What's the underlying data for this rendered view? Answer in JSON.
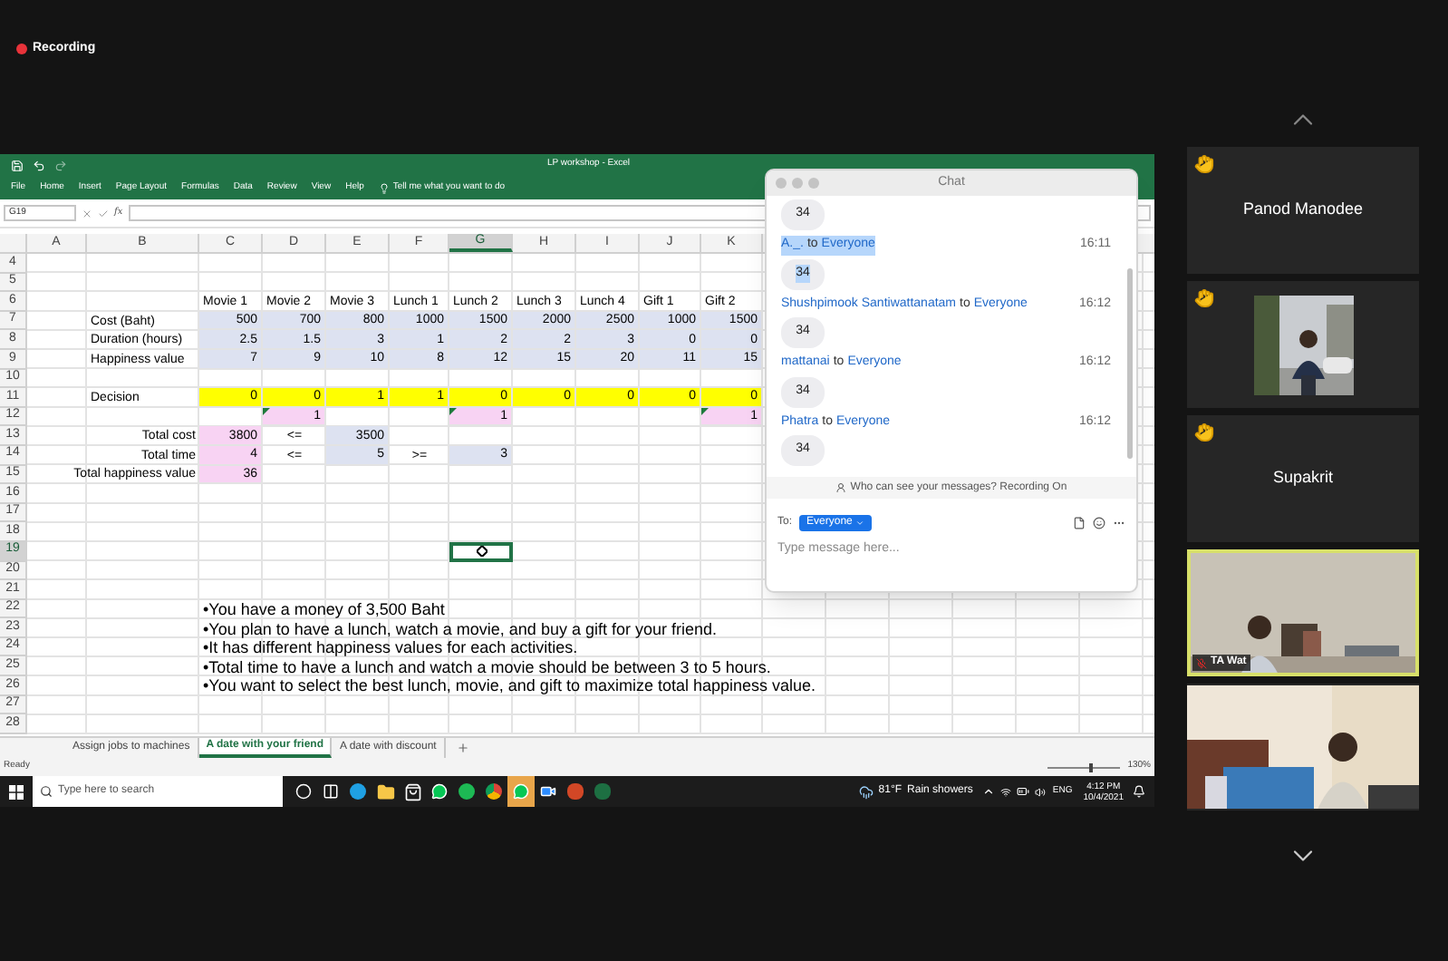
{
  "meeting": {
    "recording_label": "Recording"
  },
  "excel": {
    "title": "LP workshop - Excel",
    "menu": [
      "File",
      "Home",
      "Insert",
      "Page Layout",
      "Formulas",
      "Data",
      "Review",
      "View",
      "Help"
    ],
    "tell_me": "Tell me what you want to do",
    "name_box": "G19",
    "function_label": "fx",
    "columns": [
      {
        "label": "A",
        "selected": false
      },
      {
        "label": "B",
        "selected": false
      },
      {
        "label": "C",
        "selected": false
      },
      {
        "label": "D",
        "selected": false
      },
      {
        "label": "E",
        "selected": false
      },
      {
        "label": "F",
        "selected": false
      },
      {
        "label": "G",
        "selected": true
      },
      {
        "label": "H",
        "selected": false
      },
      {
        "label": "I",
        "selected": false
      },
      {
        "label": "J",
        "selected": false
      },
      {
        "label": "K",
        "selected": false
      }
    ],
    "rows": [
      {
        "number": "4",
        "selected": false
      },
      {
        "number": "5",
        "selected": false
      },
      {
        "number": "6",
        "selected": false,
        "cells": [
          null,
          null,
          {
            "text": "Movie 1",
            "kind": "label"
          },
          {
            "text": "Movie 2",
            "kind": "label"
          },
          {
            "text": "Movie 3",
            "kind": "label"
          },
          {
            "text": "Lunch 1",
            "kind": "label"
          },
          {
            "text": "Lunch 2",
            "kind": "label"
          },
          {
            "text": "Lunch 3",
            "kind": "label"
          },
          {
            "text": "Lunch 4",
            "kind": "label"
          },
          {
            "text": "Gift 1",
            "kind": "label"
          },
          {
            "text": "Gift 2",
            "kind": "label"
          }
        ]
      },
      {
        "number": "7",
        "selected": false,
        "cells": [
          null,
          {
            "text": "Cost (Baht)",
            "kind": "label"
          },
          {
            "text": "500",
            "kind": "number",
            "color": "#dde2f1"
          },
          {
            "text": "700",
            "kind": "number",
            "color": "#dde2f1"
          },
          {
            "text": "800",
            "kind": "number",
            "color": "#dde2f1"
          },
          {
            "text": "1000",
            "kind": "number",
            "color": "#dde2f1"
          },
          {
            "text": "1500",
            "kind": "number",
            "color": "#dde2f1"
          },
          {
            "text": "2000",
            "kind": "number",
            "color": "#dde2f1"
          },
          {
            "text": "2500",
            "kind": "number",
            "color": "#dde2f1"
          },
          {
            "text": "1000",
            "kind": "number",
            "color": "#dde2f1"
          },
          {
            "text": "1500",
            "kind": "number",
            "color": "#dde2f1"
          }
        ]
      },
      {
        "number": "8",
        "selected": false,
        "cells": [
          null,
          {
            "text": "Duration (hours)",
            "kind": "label"
          },
          {
            "text": "2.5",
            "kind": "number",
            "color": "#dde2f1"
          },
          {
            "text": "1.5",
            "kind": "number",
            "color": "#dde2f1"
          },
          {
            "text": "3",
            "kind": "number",
            "color": "#dde2f1"
          },
          {
            "text": "1",
            "kind": "number",
            "color": "#dde2f1"
          },
          {
            "text": "2",
            "kind": "number",
            "color": "#dde2f1"
          },
          {
            "text": "2",
            "kind": "number",
            "color": "#dde2f1"
          },
          {
            "text": "3",
            "kind": "number",
            "color": "#dde2f1"
          },
          {
            "text": "0",
            "kind": "number",
            "color": "#dde2f1"
          },
          {
            "text": "0",
            "kind": "number",
            "color": "#dde2f1"
          }
        ]
      },
      {
        "number": "9",
        "selected": false,
        "cells": [
          null,
          {
            "text": "Happiness value",
            "kind": "label"
          },
          {
            "text": "7",
            "kind": "number",
            "color": "#dde2f1"
          },
          {
            "text": "9",
            "kind": "number",
            "color": "#dde2f1"
          },
          {
            "text": "10",
            "kind": "number",
            "color": "#dde2f1"
          },
          {
            "text": "8",
            "kind": "number",
            "color": "#dde2f1"
          },
          {
            "text": "12",
            "kind": "number",
            "color": "#dde2f1"
          },
          {
            "text": "15",
            "kind": "number",
            "color": "#dde2f1"
          },
          {
            "text": "20",
            "kind": "number",
            "color": "#dde2f1"
          },
          {
            "text": "11",
            "kind": "number",
            "color": "#dde2f1"
          },
          {
            "text": "15",
            "kind": "number",
            "color": "#dde2f1"
          }
        ]
      },
      {
        "number": "10",
        "selected": false
      },
      {
        "number": "11",
        "selected": false,
        "cells": [
          null,
          {
            "text": "Decision",
            "kind": "label"
          },
          {
            "text": "0",
            "kind": "number",
            "color": "#ffff00"
          },
          {
            "text": "0",
            "kind": "number",
            "color": "#ffff00"
          },
          {
            "text": "1",
            "kind": "number",
            "color": "#ffff00"
          },
          {
            "text": "1",
            "kind": "number",
            "color": "#ffff00"
          },
          {
            "text": "0",
            "kind": "number",
            "color": "#ffff00"
          },
          {
            "text": "0",
            "kind": "number",
            "color": "#ffff00"
          },
          {
            "text": "0",
            "kind": "number",
            "color": "#ffff00"
          },
          {
            "text": "0",
            "kind": "number",
            "color": "#ffff00"
          },
          {
            "text": "0",
            "kind": "number",
            "color": "#ffff00"
          }
        ]
      },
      {
        "number": "12",
        "selected": false,
        "cells": [
          null,
          null,
          null,
          {
            "text": "1",
            "kind": "number",
            "color": "#f8d3f3",
            "flagged": true
          },
          null,
          null,
          {
            "text": "1",
            "kind": "number",
            "color": "#f8d3f3",
            "flagged": true
          },
          null,
          null,
          null,
          {
            "text": "1",
            "kind": "number",
            "color": "#f8d3f3",
            "flagged": true
          }
        ]
      },
      {
        "number": "13",
        "selected": false,
        "cells": [
          null,
          {
            "text": "Total cost",
            "kind": "total_label"
          },
          {
            "text": "3800",
            "kind": "number",
            "color": "#f8d3f3"
          },
          {
            "text": "<=",
            "kind": "operator"
          },
          {
            "text": "3500",
            "kind": "number",
            "color": "#dde2f1"
          }
        ]
      },
      {
        "number": "14",
        "selected": false,
        "cells": [
          null,
          {
            "text": "Total time",
            "kind": "total_label"
          },
          {
            "text": "4",
            "kind": "number",
            "color": "#f8d3f3"
          },
          {
            "text": "<=",
            "kind": "operator"
          },
          {
            "text": "5",
            "kind": "number",
            "color": "#dde2f1"
          },
          {
            "text": ">=",
            "kind": "operator"
          },
          {
            "text": "3",
            "kind": "number",
            "color": "#dde2f1"
          }
        ]
      },
      {
        "number": "15",
        "selected": false,
        "cells": [
          null,
          {
            "text": "Total happiness value",
            "kind": "total_label"
          },
          {
            "text": "36",
            "kind": "number",
            "color": "#f8d3f3"
          }
        ]
      },
      {
        "number": "16",
        "selected": false
      },
      {
        "number": "17",
        "selected": false
      },
      {
        "number": "18",
        "selected": false
      },
      {
        "number": "19",
        "selected": true
      },
      {
        "number": "20",
        "selected": false
      },
      {
        "number": "21",
        "selected": false
      },
      {
        "number": "22",
        "selected": false,
        "cells": [
          null,
          null,
          {
            "text": "•You have a money of 3,500 Baht",
            "kind": "note"
          }
        ]
      },
      {
        "number": "23",
        "selected": false,
        "cells": [
          null,
          null,
          {
            "text": "•You plan to have a lunch, watch a movie, and buy a gift for your friend.",
            "kind": "note"
          }
        ]
      },
      {
        "number": "24",
        "selected": false,
        "cells": [
          null,
          null,
          {
            "text": "•It has different happiness values for each activities.",
            "kind": "note"
          }
        ]
      },
      {
        "number": "25",
        "selected": false,
        "cells": [
          null,
          null,
          {
            "text": "•Total time to have a lunch and watch a movie should be between 3 to 5 hours.",
            "kind": "note"
          }
        ]
      },
      {
        "number": "26",
        "selected": false,
        "cells": [
          null,
          null,
          {
            "text": "•You want to select the best lunch, movie, and gift to maximize total happiness value.",
            "kind": "note"
          }
        ]
      },
      {
        "number": "27",
        "selected": false
      },
      {
        "number": "28",
        "selected": false
      }
    ],
    "sheet_tabs": [
      {
        "label": "Assign jobs to machines",
        "selected": false
      },
      {
        "label": "A date with your friend",
        "selected": true
      },
      {
        "label": "A date with discount",
        "selected": false
      }
    ],
    "status": "Ready",
    "zoom_slider": {
      "level": 0.6
    },
    "zoom": "130%"
  },
  "taskbar": {
    "search_placeholder": "Type here to search",
    "apps": [
      {
        "kind": "cortana",
        "selected": false
      },
      {
        "kind": "taskview",
        "selected": false
      },
      {
        "kind": "edge",
        "selected": false
      },
      {
        "kind": "folder",
        "selected": false
      },
      {
        "kind": "store",
        "selected": false
      },
      {
        "kind": "line",
        "selected": false
      },
      {
        "kind": "spotify",
        "selected": false
      },
      {
        "kind": "chrome",
        "selected": false
      },
      {
        "kind": "line",
        "selected": true
      },
      {
        "kind": "zoom",
        "selected": false
      },
      {
        "kind": "powerpoint",
        "selected": false
      },
      {
        "kind": "excel",
        "selected": false
      }
    ],
    "temperature": "81°F",
    "weather": "Rain showers",
    "language": "ENG",
    "time": "4:12 PM",
    "date": "10/4/2021"
  },
  "chat": {
    "title": "Chat",
    "messages": [
      {
        "text": "34",
        "highlighted": false
      },
      {
        "sender": "A._.",
        "to_word": "to",
        "recipient": "Everyone",
        "time": "16:11",
        "text": "34",
        "highlighted": true
      },
      {
        "sender": "Shushpimook Santiwattanatam",
        "to_word": "to",
        "recipient": "Everyone",
        "time": "16:12",
        "text": "34",
        "highlighted": false
      },
      {
        "sender": "mattanai",
        "to_word": "to",
        "recipient": "Everyone",
        "time": "16:12",
        "text": "34",
        "highlighted": false
      },
      {
        "sender": "Phatra",
        "to_word": "to",
        "recipient": "Everyone",
        "time": "16:12",
        "text": "34",
        "highlighted": false
      }
    ],
    "notice": "Who can see your messages? Recording On",
    "to_label": "To:",
    "recipient": "Everyone",
    "placeholder": "Type message here..."
  },
  "participants": [
    {
      "kind": "name",
      "name": "Panod Manodee",
      "hand_raised": true,
      "speaking": false
    },
    {
      "kind": "picture",
      "hand_raised": true,
      "speaking": false
    },
    {
      "kind": "name",
      "name": "Supakrit",
      "hand_raised": true,
      "speaking": false
    },
    {
      "kind": "picture",
      "name": "TA Wat",
      "muted": true,
      "speaking": true,
      "hand_raised": false
    },
    {
      "kind": "picture",
      "hand_raised": false,
      "speaking": false
    }
  ]
}
